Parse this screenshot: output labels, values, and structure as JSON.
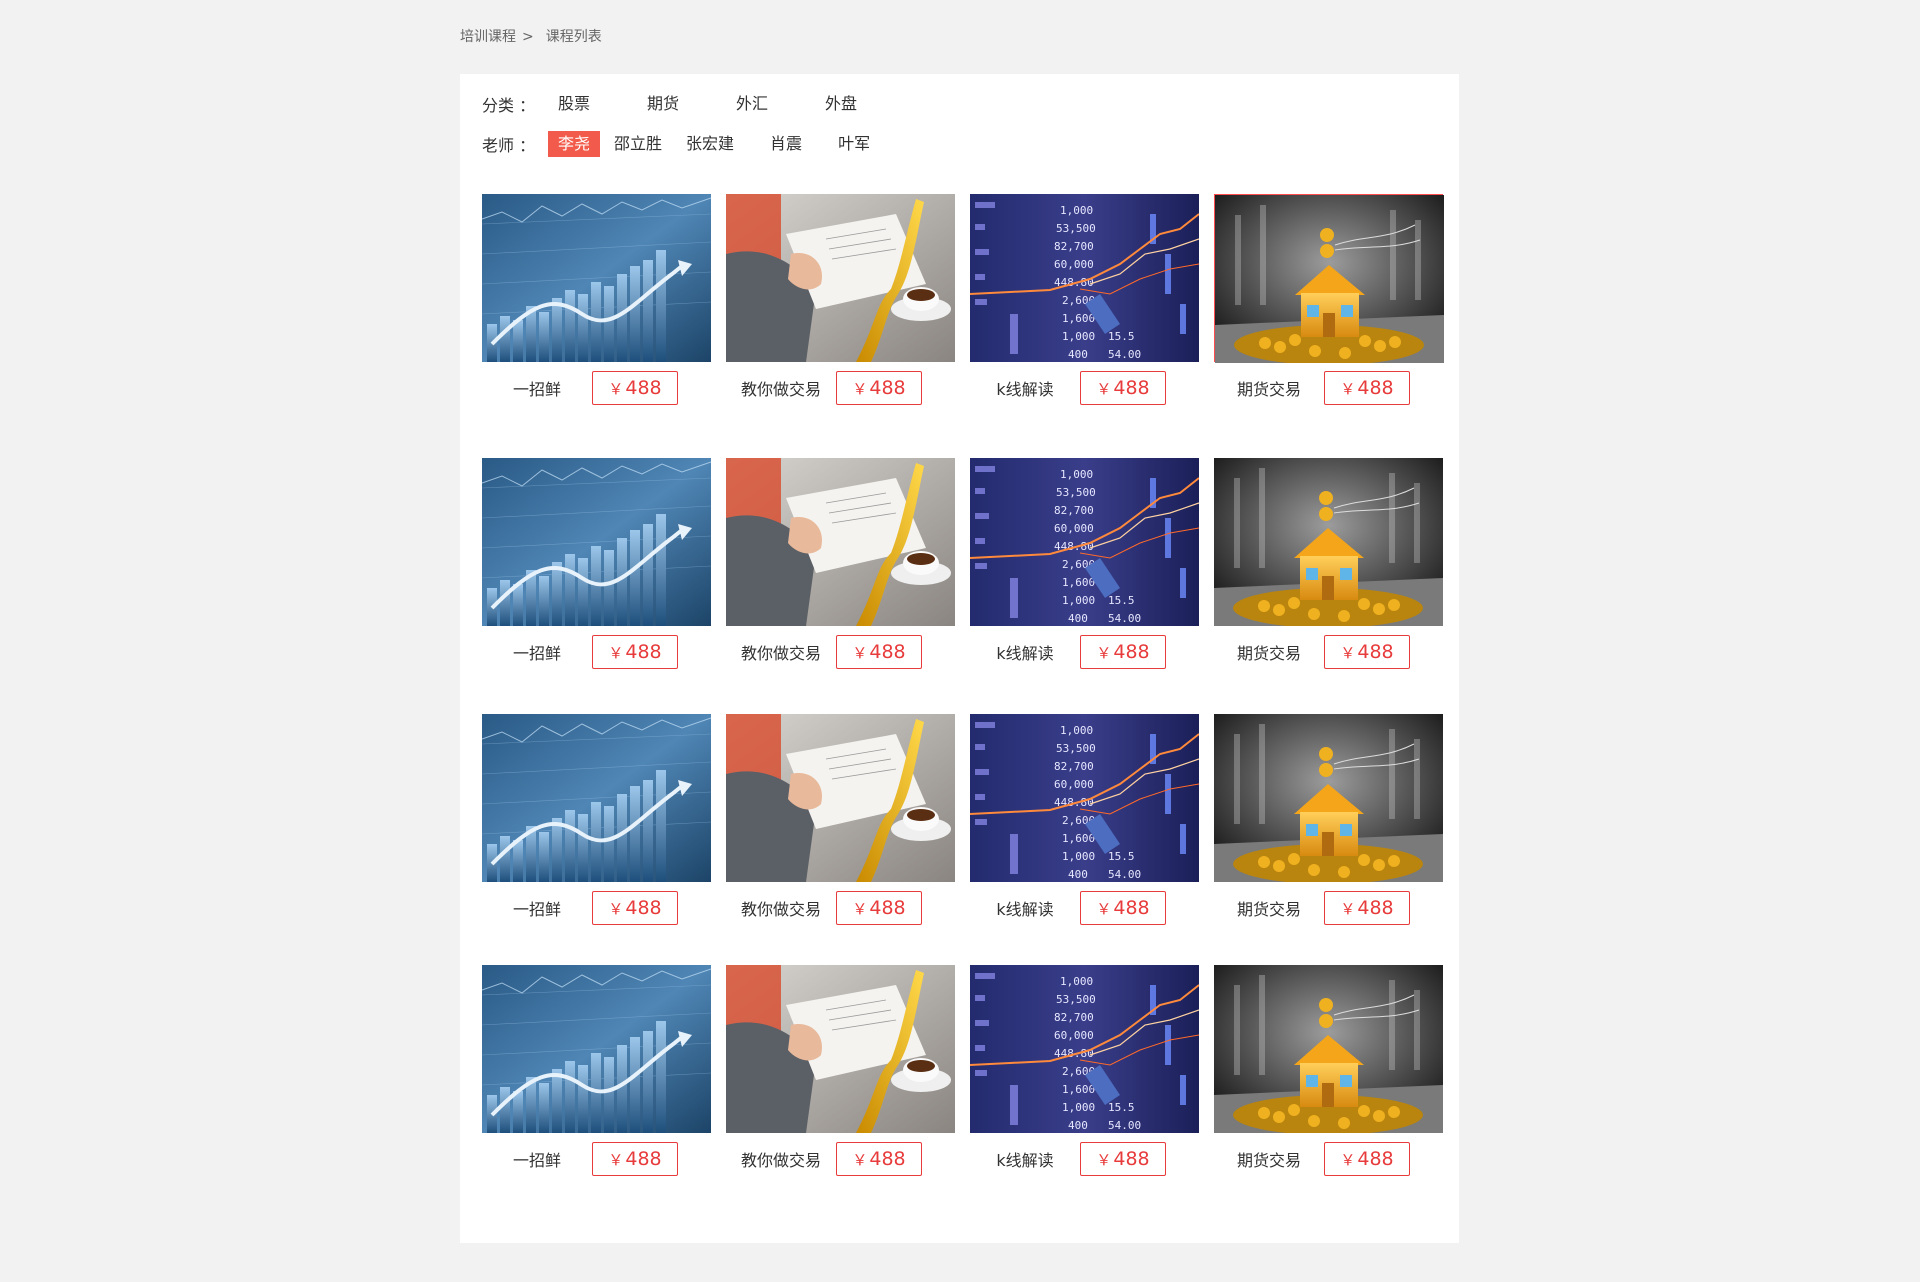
{
  "breadcrumb": {
    "parent": "培训课程",
    "separator": ">",
    "current": "课程列表"
  },
  "filters": {
    "category": {
      "label": "分类 ：",
      "options": [
        "股票",
        "期货",
        "外汇",
        "外盘"
      ]
    },
    "teacher": {
      "label": "老师 ：",
      "options": [
        "李尧",
        "邵立胜",
        "张宏建",
        "肖震",
        "叶军"
      ],
      "selected": "李尧"
    }
  },
  "courses": [
    {
      "title": "一招鲜",
      "price": "488",
      "currency": "￥",
      "image": "blue-stock-chart"
    },
    {
      "title": "教你做交易",
      "price": "488",
      "currency": "￥",
      "image": "businessman-writing"
    },
    {
      "title": "k线解读",
      "price": "488",
      "currency": "￥",
      "image": "stock-ticker-board"
    },
    {
      "title": "期货交易",
      "price": "488",
      "currency": "￥",
      "image": "gold-house-coins"
    },
    {
      "title": "一招鲜",
      "price": "488",
      "currency": "￥",
      "image": "blue-stock-chart"
    },
    {
      "title": "教你做交易",
      "price": "488",
      "currency": "￥",
      "image": "businessman-writing"
    },
    {
      "title": "k线解读",
      "price": "488",
      "currency": "￥",
      "image": "stock-ticker-board"
    },
    {
      "title": "期货交易",
      "price": "488",
      "currency": "￥",
      "image": "gold-house-coins"
    },
    {
      "title": "一招鲜",
      "price": "488",
      "currency": "￥",
      "image": "blue-stock-chart"
    },
    {
      "title": "教你做交易",
      "price": "488",
      "currency": "￥",
      "image": "businessman-writing"
    },
    {
      "title": "k线解读",
      "price": "488",
      "currency": "￥",
      "image": "stock-ticker-board"
    },
    {
      "title": "期货交易",
      "price": "488",
      "currency": "￥",
      "image": "gold-house-coins"
    },
    {
      "title": "一招鲜",
      "price": "488",
      "currency": "￥",
      "image": "blue-stock-chart"
    },
    {
      "title": "教你做交易",
      "price": "488",
      "currency": "￥",
      "image": "businessman-writing"
    },
    {
      "title": "k线解读",
      "price": "488",
      "currency": "￥",
      "image": "stock-ticker-board"
    },
    {
      "title": "期货交易",
      "price": "488",
      "currency": "￥",
      "image": "gold-house-coins"
    }
  ],
  "colors": {
    "page_bg": "#f2f2f2",
    "panel_bg": "#ffffff",
    "accent_red": "#e83b3b",
    "active_filter_bg": "#f25b4b"
  }
}
